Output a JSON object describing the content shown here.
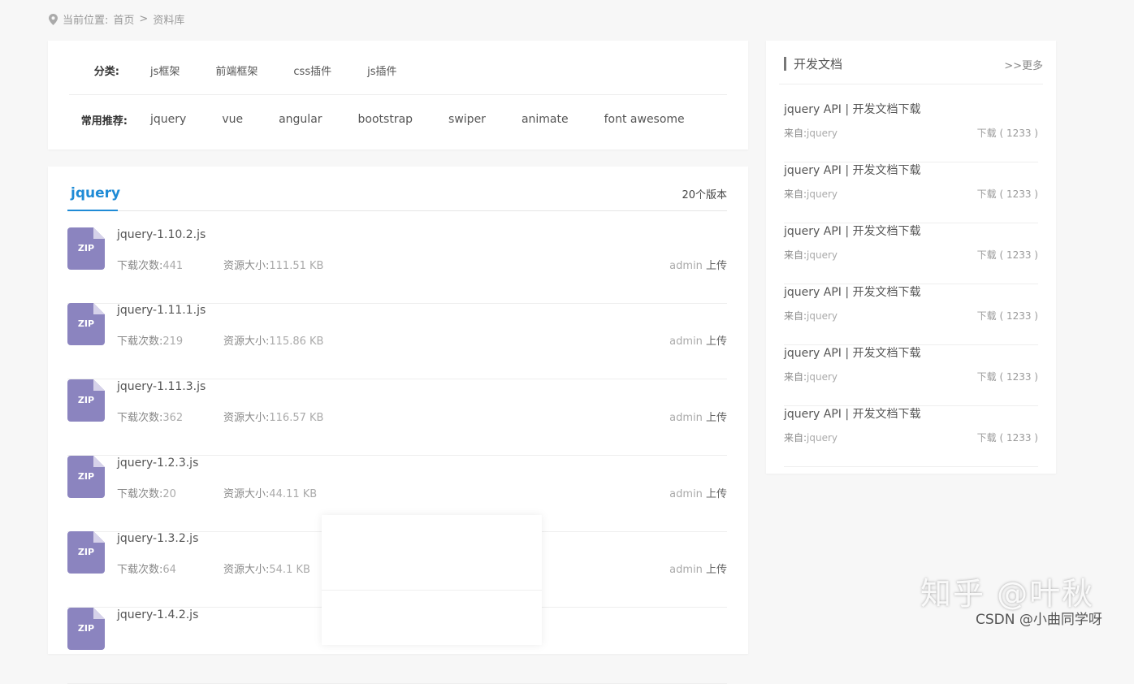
{
  "breadcrumb": {
    "label": "当前位置:",
    "home": "首页",
    "sep": ">",
    "current": "资料库"
  },
  "filters": {
    "category_label": "分类:",
    "categories": [
      "js框架",
      "前端框架",
      "css插件",
      "js插件"
    ],
    "recommend_label": "常用推荐:",
    "recommends": [
      "jquery",
      "vue",
      "angular",
      "bootstrap",
      "swiper",
      "animate",
      "font awesome"
    ]
  },
  "library": {
    "active_tab": "jquery",
    "version_count": "20个版本",
    "download_label": "下载次数:",
    "size_label": "资源大小:",
    "uploader_name": "admin",
    "uploader_action": "上传",
    "file_badge": "ZIP",
    "items": [
      {
        "name": "jquery-1.10.2.js",
        "downloads": "441",
        "size": "111.51 KB"
      },
      {
        "name": "jquery-1.11.1.js",
        "downloads": "219",
        "size": "115.86 KB"
      },
      {
        "name": "jquery-1.11.3.js",
        "downloads": "362",
        "size": "116.57 KB"
      },
      {
        "name": "jquery-1.2.3.js",
        "downloads": "20",
        "size": "44.11 KB"
      },
      {
        "name": "jquery-1.3.2.js",
        "downloads": "64",
        "size": "54.1 KB"
      },
      {
        "name": "jquery-1.4.2.js",
        "downloads": "",
        "size": ""
      }
    ]
  },
  "sidebar": {
    "title": "开发文档",
    "more": ">>更多",
    "from_label": "来自:",
    "docs": [
      {
        "title": "jquery API | 开发文档下载",
        "from": "jquery",
        "downloads": "下载 ( 1233 )"
      },
      {
        "title": "jquery API | 开发文档下载",
        "from": "jquery",
        "downloads": "下载 ( 1233 )"
      },
      {
        "title": "jquery API | 开发文档下载",
        "from": "jquery",
        "downloads": "下载 ( 1233 )"
      },
      {
        "title": "jquery API | 开发文档下载",
        "from": "jquery",
        "downloads": "下载 ( 1233 )"
      },
      {
        "title": "jquery API | 开发文档下载",
        "from": "jquery",
        "downloads": "下载 ( 1233 )"
      },
      {
        "title": "jquery API | 开发文档下载",
        "from": "jquery",
        "downloads": "下载 ( 1233 )"
      }
    ]
  },
  "watermark": {
    "zhihu": "知乎 @叶秋",
    "csdn": "CSDN @小曲同学呀"
  },
  "colors": {
    "accent": "#1f8bd6",
    "zip_icon": "#8b84bf"
  }
}
